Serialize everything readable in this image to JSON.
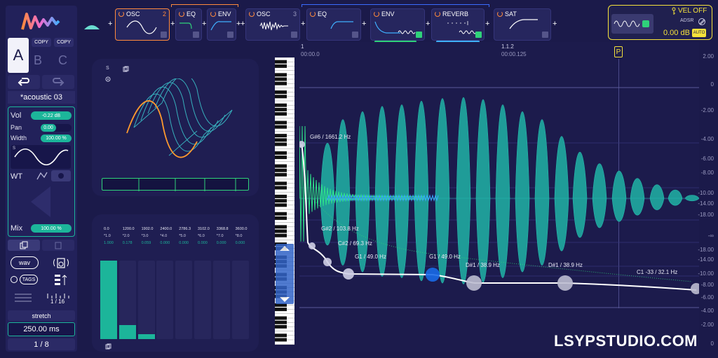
{
  "logo": {
    "icon": "wave-logo-icon"
  },
  "snapshots": {
    "active": "A",
    "copy1": "COPY",
    "copy2": "COPY",
    "b": "B",
    "c": "C"
  },
  "preset": {
    "name": "*acoustic 03"
  },
  "controls": {
    "vol_label": "Vol",
    "vol_value": "-0.22 dB",
    "pan_label": "Pan",
    "pan_value": "0.00",
    "width_label": "Width",
    "width_value": "100.00 %",
    "wt_label": "WT",
    "mix_label": "Mix",
    "mix_value": "100.00 %"
  },
  "tools": {
    "wav_label": "wav",
    "tags_label": "TAGS",
    "grid_value": "1 / 16",
    "stretch_label": "stretch",
    "time_value": "250.00 ms",
    "fraction_value": "1 / 8"
  },
  "chain": {
    "modules": [
      {
        "name": "OSC",
        "count": "2"
      },
      {
        "name": "EQ"
      },
      {
        "name": "ENV"
      },
      {
        "name": "OSC",
        "count": "3"
      },
      {
        "name": "EQ"
      },
      {
        "name": "ENV"
      },
      {
        "name": "REVERB"
      },
      {
        "name": "SAT"
      }
    ],
    "plus": "+"
  },
  "vel": {
    "label": "VEL OFF",
    "sub": "ADSR",
    "gain": "0.00 dB",
    "auto": "AUTO"
  },
  "timeline": {
    "marker1": "1",
    "time1": "00:00.0",
    "marker2": "1.1.2",
    "time2": "00:00.125",
    "playhead": "P"
  },
  "db_scale": [
    "2.00",
    "0",
    "-2.00",
    "-4.00",
    "-6.00",
    "-8.00",
    "-10.00",
    "-14.00",
    "-18.00",
    "-∞",
    "-18.00",
    "-14.00",
    "-10.00",
    "-8.00",
    "-6.00",
    "-4.00",
    "-2.00",
    "0"
  ],
  "notes": [
    {
      "label": "G#6 / 1661.2 Hz"
    },
    {
      "label": "G#2 / 103.8 Hz"
    },
    {
      "label": "C#2 / 69.3 Hz"
    },
    {
      "label": "G1 / 49.0 Hz"
    },
    {
      "label": "G1 / 49.0 Hz"
    },
    {
      "label": "D#1 / 38.9 Hz"
    },
    {
      "label": "D#1 / 38.9 Hz"
    },
    {
      "label": "C1 -33 / 32.1 Hz"
    }
  ],
  "spectrum": {
    "top_row": [
      "0.0",
      "1200.0",
      "1902.0",
      "2400.0",
      "2786.3",
      "3102.0",
      "3368.8",
      "3600.0"
    ],
    "mid_row": [
      "*1.0",
      "*2.0",
      "*3.0",
      "*4.0",
      "*5.0",
      "*6.0",
      "*7.0",
      "*8.0"
    ],
    "low_row": [
      "1.000",
      "0.178",
      "0.059",
      "0.000",
      "0.000",
      "0.000",
      "0.000",
      "0.000"
    ],
    "levels": [
      1.0,
      0.178,
      0.059,
      0,
      0,
      0,
      0,
      0
    ]
  },
  "wt_view": {
    "s_label": "S"
  },
  "watermark": "LSYPSTUDIO.COM",
  "colors": {
    "accent_teal": "#1cb59a",
    "accent_orange": "#ff8a3d",
    "accent_yellow": "#f5e23b",
    "bg": "#1b1a4a"
  }
}
